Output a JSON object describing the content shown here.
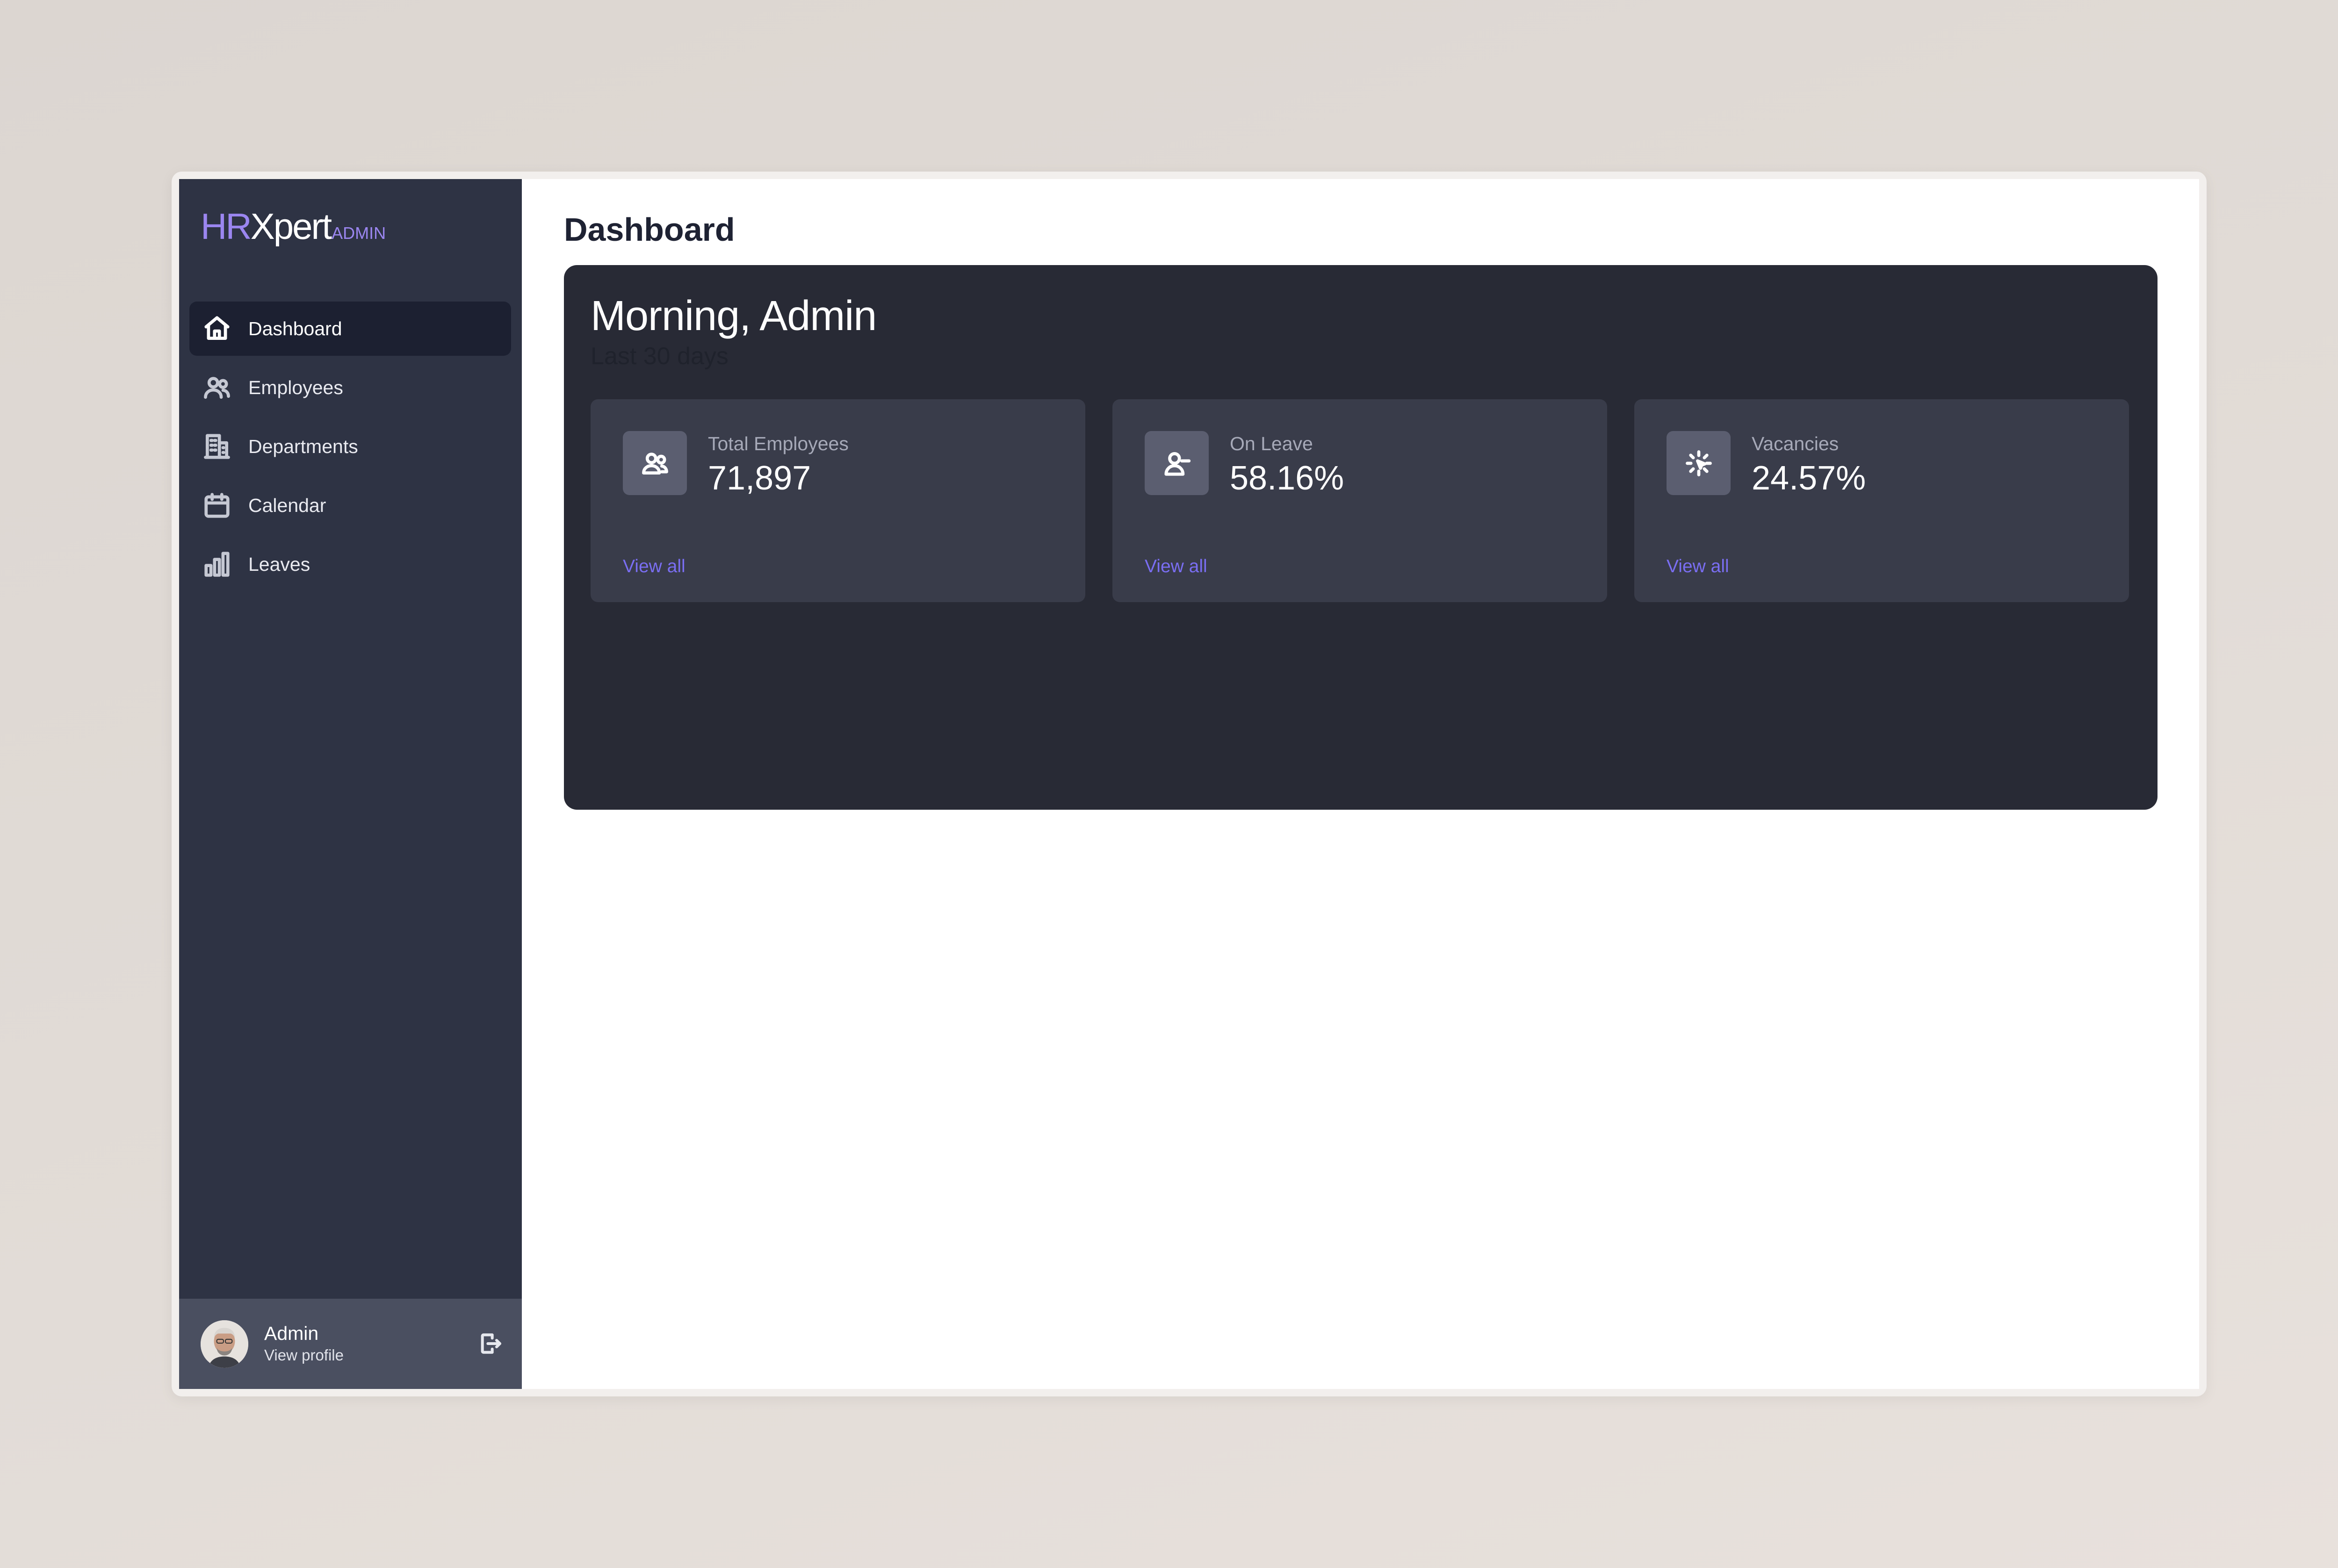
{
  "logo": {
    "part1": "HR",
    "part2": "Xpert",
    "suffix": "ADMIN"
  },
  "nav": {
    "items": [
      {
        "label": "Dashboard",
        "icon": "home-icon",
        "active": true
      },
      {
        "label": "Employees",
        "icon": "users-icon",
        "active": false
      },
      {
        "label": "Departments",
        "icon": "building-icon",
        "active": false
      },
      {
        "label": "Calendar",
        "icon": "calendar-icon",
        "active": false
      },
      {
        "label": "Leaves",
        "icon": "bar-chart-icon",
        "active": false
      }
    ]
  },
  "profile": {
    "name": "Admin",
    "link": "View profile"
  },
  "page": {
    "title": "Dashboard"
  },
  "welcome": {
    "greeting": "Morning, Admin",
    "subtitle": "Last 30 days"
  },
  "stats": [
    {
      "label": "Total Employees",
      "value": "71,897",
      "link": "View all",
      "icon": "users-icon"
    },
    {
      "label": "On Leave",
      "value": "58.16%",
      "link": "View all",
      "icon": "user-minus-icon"
    },
    {
      "label": "Vacancies",
      "value": "24.57%",
      "link": "View all",
      "icon": "cursor-click-icon"
    }
  ],
  "colors": {
    "sidebar_bg": "#2e3344",
    "panel_bg": "#282a35",
    "card_bg": "#393c4a",
    "accent": "#9b86f0",
    "link": "#7a6ef2"
  }
}
